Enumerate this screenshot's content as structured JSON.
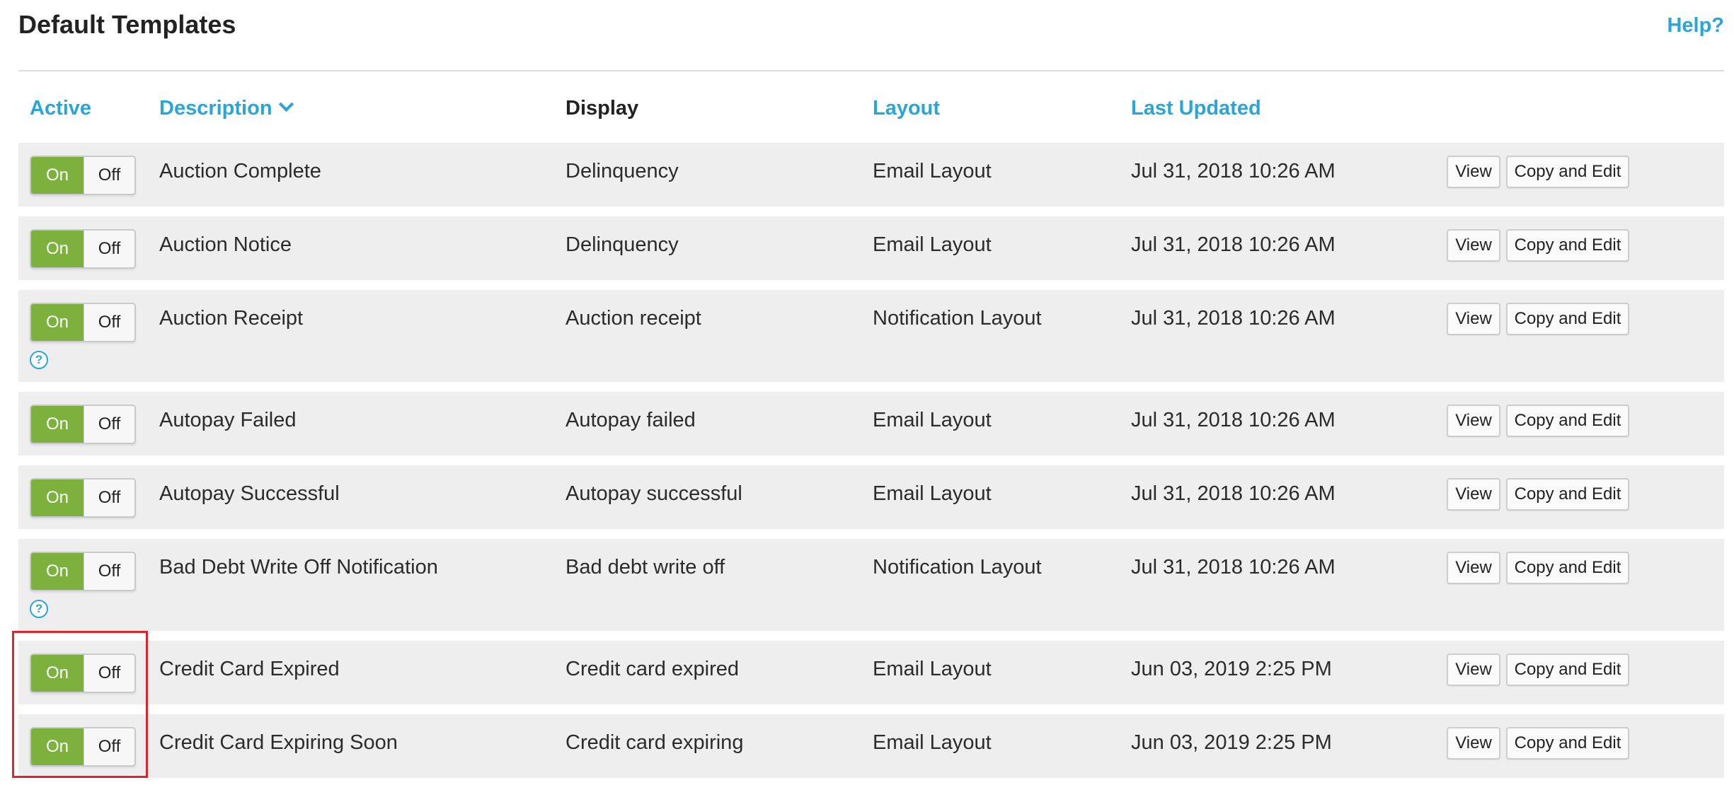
{
  "header": {
    "title": "Default Templates",
    "help_label": "Help?"
  },
  "columns": {
    "active": "Active",
    "description": "Description",
    "display": "Display",
    "layout": "Layout",
    "last_updated": "Last Updated"
  },
  "toggle": {
    "on_label": "On",
    "off_label": "Off"
  },
  "help_icon_glyph": "?",
  "actions": {
    "view_label": "View",
    "copy_edit_label": "Copy and Edit"
  },
  "rows": [
    {
      "active": true,
      "description": "Auction Complete",
      "display": "Delinquency",
      "layout": "Email Layout",
      "last_updated": "Jul 31, 2018 10:26 AM",
      "has_help": false
    },
    {
      "active": true,
      "description": "Auction Notice",
      "display": "Delinquency",
      "layout": "Email Layout",
      "last_updated": "Jul 31, 2018 10:26 AM",
      "has_help": false
    },
    {
      "active": true,
      "description": "Auction Receipt",
      "display": "Auction receipt",
      "layout": "Notification Layout",
      "last_updated": "Jul 31, 2018 10:26 AM",
      "has_help": true
    },
    {
      "active": true,
      "description": "Autopay Failed",
      "display": "Autopay failed",
      "layout": "Email Layout",
      "last_updated": "Jul 31, 2018 10:26 AM",
      "has_help": false
    },
    {
      "active": true,
      "description": "Autopay Successful",
      "display": "Autopay successful",
      "layout": "Email Layout",
      "last_updated": "Jul 31, 2018 10:26 AM",
      "has_help": false
    },
    {
      "active": true,
      "description": "Bad Debt Write Off Notification",
      "display": "Bad debt write off",
      "layout": "Notification Layout",
      "last_updated": "Jul 31, 2018 10:26 AM",
      "has_help": true
    },
    {
      "active": true,
      "description": "Credit Card Expired",
      "display": "Credit card expired",
      "layout": "Email Layout",
      "last_updated": "Jun 03, 2019 2:25 PM",
      "has_help": false
    },
    {
      "active": true,
      "description": "Credit Card Expiring Soon",
      "display": "Credit card expiring",
      "layout": "Email Layout",
      "last_updated": "Jun 03, 2019 2:25 PM",
      "has_help": false
    }
  ],
  "colors": {
    "accent": "#29a6d9",
    "toggle_on": "#7cb13e",
    "row_bg": "#eeeeee",
    "highlight": "#e0242a"
  }
}
